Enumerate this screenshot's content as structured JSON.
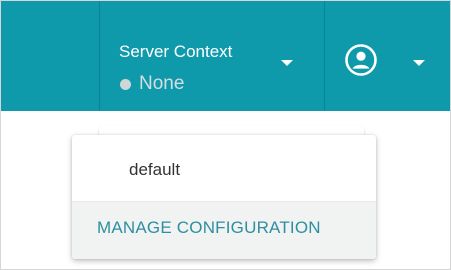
{
  "header": {
    "server_context_label": "Server Context",
    "server_context_value": "None",
    "status_dot_color": "#cfd6d8",
    "bar_color": "#0f9aac"
  },
  "icons": {
    "server_context_caret": "caret-down-icon",
    "user_avatar": "user-circle-icon",
    "user_caret": "caret-down-icon"
  },
  "dropdown": {
    "options": [
      "default"
    ],
    "manage_label": "MANAGE CONFIGURATION",
    "manage_color": "#2e8fa0"
  }
}
